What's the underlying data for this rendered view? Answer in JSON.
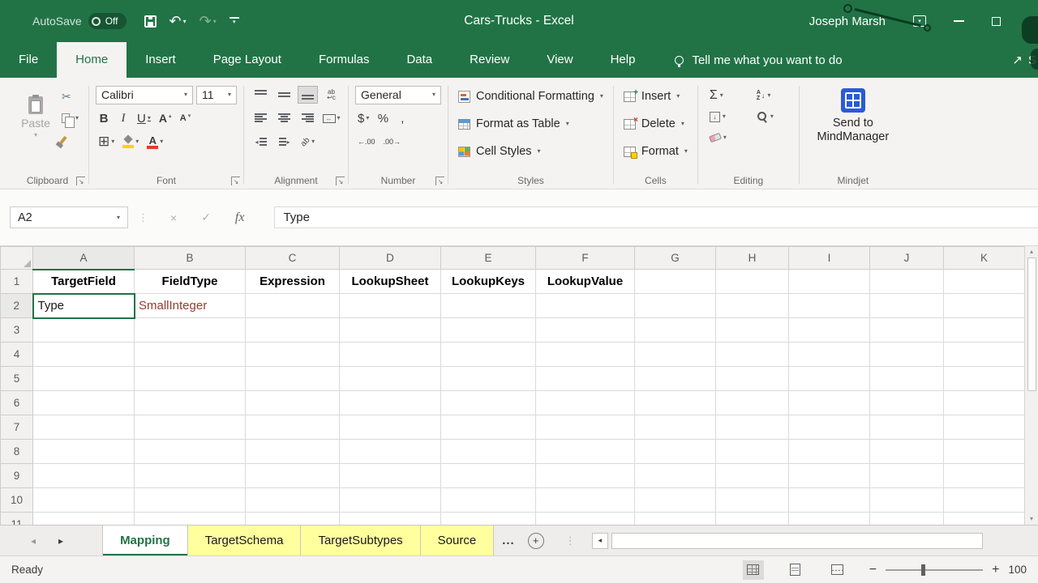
{
  "colors": {
    "excel_green": "#217346",
    "tab_yellow": "#ffff9e",
    "selection_green": "#217346",
    "fieldtype_text": "#963c2e"
  },
  "title_bar": {
    "autosave_label": "AutoSave",
    "autosave_state": "Off",
    "document_title": "Cars-Trucks  -  Excel",
    "user_name": "Joseph Marsh"
  },
  "menu_bar": {
    "tabs": [
      "File",
      "Home",
      "Insert",
      "Page Layout",
      "Formulas",
      "Data",
      "Review",
      "View",
      "Help"
    ],
    "active_tab": "Home",
    "tell_me": "Tell me what you want to do",
    "share_label": "S"
  },
  "ribbon": {
    "clipboard": {
      "group_label": "Clipboard",
      "paste_label": "Paste"
    },
    "font": {
      "group_label": "Font",
      "font_name": "Calibri",
      "font_size": "11",
      "bold": "B",
      "italic": "I",
      "underline": "U"
    },
    "alignment": {
      "group_label": "Alignment",
      "wrap_top": "ab",
      "wrap_bottom": "↩c",
      "merge_glyph": "↔",
      "orient_glyph": "ab"
    },
    "number": {
      "group_label": "Number",
      "format": "General",
      "currency": "$",
      "percent": "%",
      "comma": ",",
      "increase_decimal": "←.00",
      "decrease_decimal": ".00→"
    },
    "styles": {
      "group_label": "Styles",
      "conditional_formatting": "Conditional Formatting",
      "format_as_table": "Format as Table",
      "cell_styles": "Cell Styles"
    },
    "cells": {
      "group_label": "Cells",
      "insert": "Insert",
      "delete": "Delete",
      "format": "Format"
    },
    "editing": {
      "group_label": "Editing",
      "autosum": "Σ"
    },
    "mindjet": {
      "group_label": "Mindjet",
      "send_button": "Send to MindManager"
    }
  },
  "formula_bar": {
    "name_box": "A2",
    "fx_label": "fx",
    "value": "Type"
  },
  "grid": {
    "column_headers": [
      "A",
      "B",
      "C",
      "D",
      "E",
      "F",
      "G",
      "H",
      "I",
      "J",
      "K"
    ],
    "active_cell": "A2",
    "cell_colors": {
      "B2": "#963c2e"
    },
    "rows": [
      {
        "n": "1",
        "header": true,
        "cells": [
          "TargetField",
          "FieldType",
          "Expression",
          "LookupSheet",
          "LookupKeys",
          "LookupValue",
          "",
          "",
          "",
          "",
          ""
        ]
      },
      {
        "n": "2",
        "cells": [
          "Type",
          "SmallInteger",
          "",
          "",
          "",
          "",
          "",
          "",
          "",
          "",
          ""
        ]
      },
      {
        "n": "3",
        "cells": []
      },
      {
        "n": "4",
        "cells": []
      },
      {
        "n": "5",
        "cells": []
      },
      {
        "n": "6",
        "cells": []
      },
      {
        "n": "7",
        "cells": []
      },
      {
        "n": "8",
        "cells": []
      },
      {
        "n": "9",
        "cells": []
      },
      {
        "n": "10",
        "cells": []
      },
      {
        "n": "11",
        "cells": []
      }
    ]
  },
  "sheet_tabs": {
    "tabs": [
      {
        "label": "Mapping",
        "active": true
      },
      {
        "label": "TargetSchema",
        "active": false
      },
      {
        "label": "TargetSubtypes",
        "active": false
      },
      {
        "label": "Source",
        "active": false
      }
    ],
    "overflow_indicator": "..."
  },
  "status_bar": {
    "mode": "Ready",
    "zoom_level": "100"
  }
}
